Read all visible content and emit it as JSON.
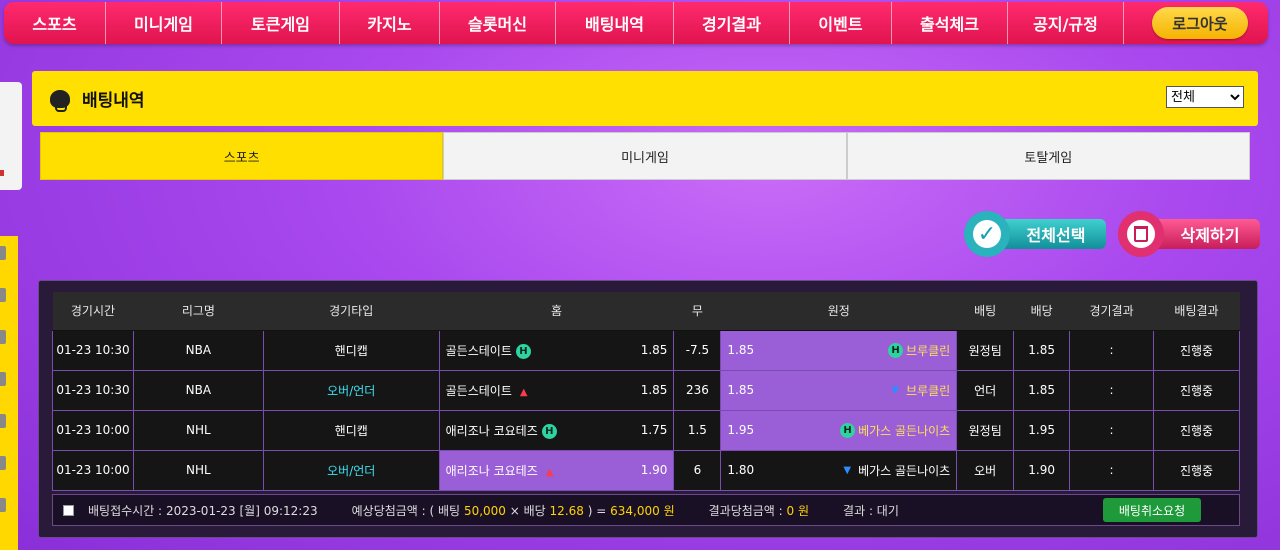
{
  "nav": {
    "items": [
      "스포츠",
      "미니게임",
      "토큰게임",
      "카지노",
      "슬롯머신",
      "배팅내역",
      "경기결과",
      "이벤트",
      "출석체크",
      "공지/규정"
    ],
    "logout": "로그아웃"
  },
  "panel": {
    "title": "배팅내역",
    "filter_selected": "전체",
    "tabs": [
      "스포츠",
      "미니게임",
      "토탈게임"
    ],
    "active_tab": "스포츠"
  },
  "actions": {
    "select_all": "전체선택",
    "delete": "삭제하기"
  },
  "table": {
    "headers": [
      "경기시간",
      "리그명",
      "경기타입",
      "홈",
      "무",
      "원정",
      "배팅",
      "배당",
      "경기결과",
      "배팅결과"
    ],
    "rows": [
      {
        "time": "01-23 10:30",
        "league": "NBA",
        "type": "핸디캡",
        "home": "골든스테이트",
        "home_odds": "1.85",
        "draw": "-7.5",
        "away_odds": "1.85",
        "away": "브루클린",
        "pick": "원정팀",
        "odds": "1.85",
        "result": ":",
        "status": "진행중"
      },
      {
        "time": "01-23 10:30",
        "league": "NBA",
        "type": "오버/언더",
        "home": "골든스테이트",
        "home_odds": "1.85",
        "draw": "236",
        "away_odds": "1.85",
        "away": "브루클린",
        "pick": "언더",
        "odds": "1.85",
        "result": ":",
        "status": "진행중"
      },
      {
        "time": "01-23 10:00",
        "league": "NHL",
        "type": "핸디캡",
        "home": "애리조나 코요테즈",
        "home_odds": "1.75",
        "draw": "1.5",
        "away_odds": "1.95",
        "away": "베가스 골든나이츠",
        "pick": "원정팀",
        "odds": "1.95",
        "result": ":",
        "status": "진행중"
      },
      {
        "time": "01-23 10:00",
        "league": "NHL",
        "type": "오버/언더",
        "home": "애리조나 코요테즈",
        "home_odds": "1.90",
        "draw": "6",
        "away_odds": "1.80",
        "away": "베가스 골든나이츠",
        "pick": "오버",
        "odds": "1.90",
        "result": ":",
        "status": "진행중"
      }
    ],
    "handicap_badge": "H"
  },
  "summary": {
    "received_label": "배팅접수시간 :",
    "received_value": "2023-01-23 [월] 09:12:23",
    "expected_label": "예상당첨금액 : ( 배팅",
    "bet_amount": "50,000",
    "times": "× 배당",
    "total_odds": "12.68",
    "equals": ") =",
    "expected_amount": "634,000 원",
    "win_label": "결과당첨금액 :",
    "win_amount": "0 원",
    "result_label": "결과 : 대기",
    "cancel": "배팅취소요청"
  }
}
